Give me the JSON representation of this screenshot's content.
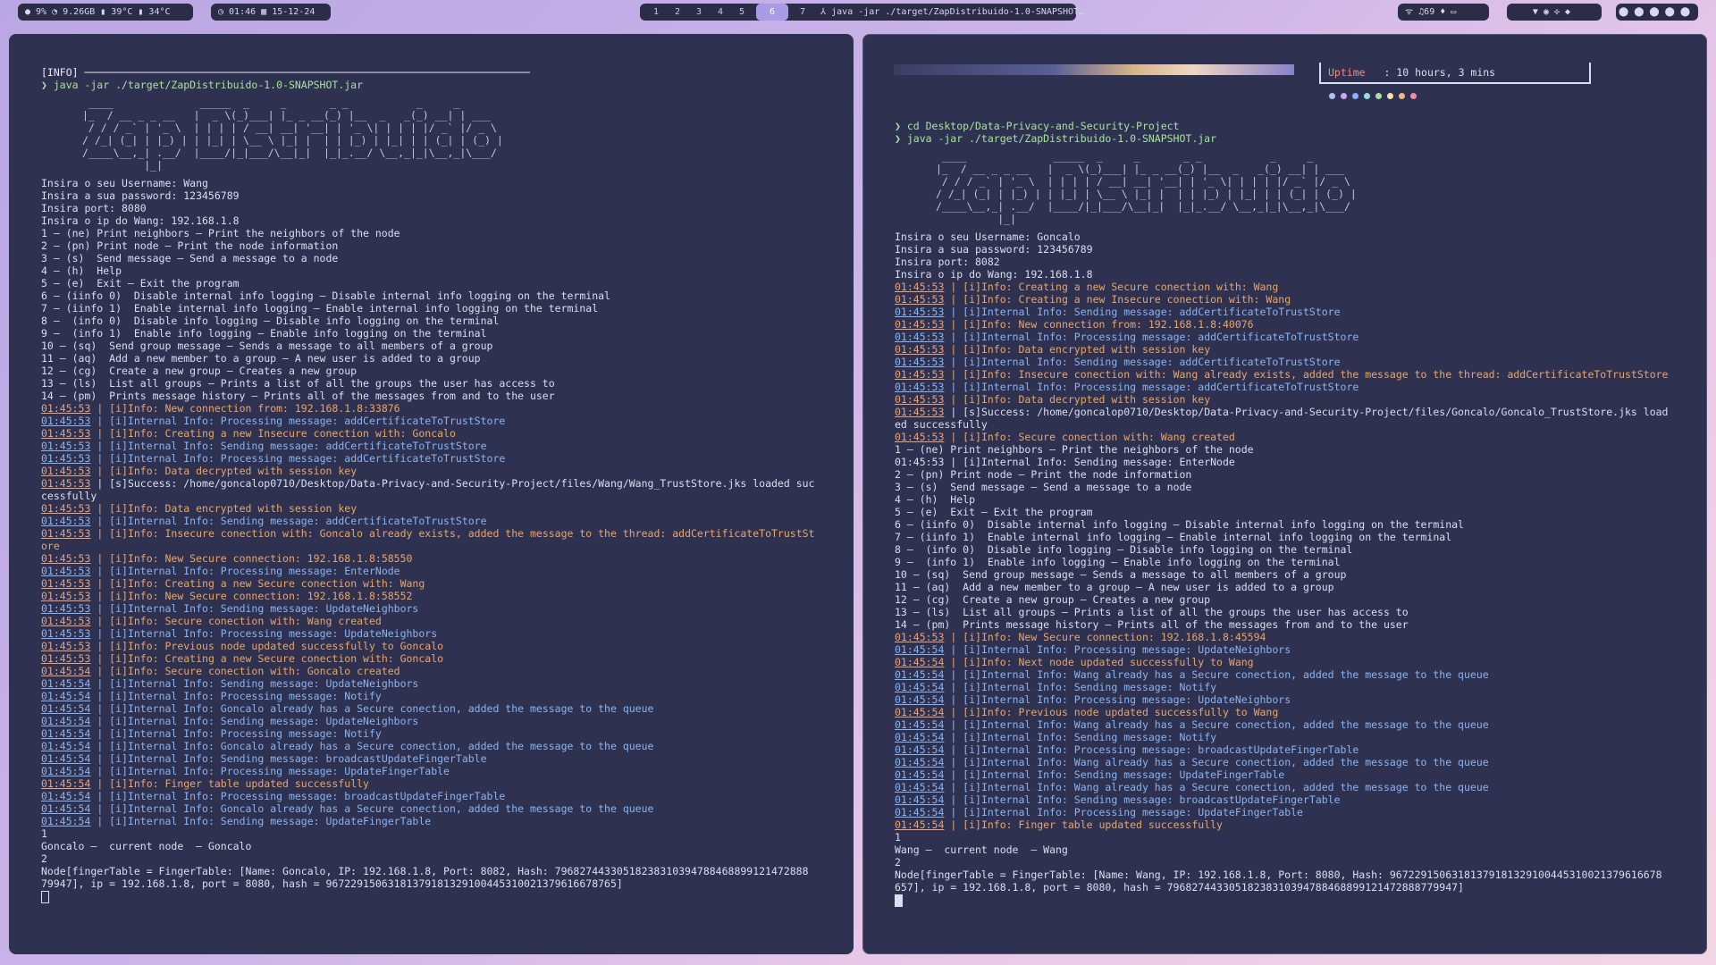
{
  "topbar": {
    "stats": [
      "● 9%",
      "◔ 9.26GB",
      "▮ 39°C",
      "▮ 34°C"
    ],
    "clock": "◷ 01:46",
    "date": "▦ 15-12-24",
    "workspaces": [
      "1",
      "2",
      "3",
      "4",
      "5",
      "6",
      "7"
    ],
    "active_workspace": "6",
    "window_title": "⅄ java -jar ./target/ZapDistribuido-1.0-SNAPSHOT…",
    "wifi": "ᯤ ♫69 ♦ ▭",
    "tray": "▼ ◉ ✣ ◆",
    "icons": "⬤ ⬤ ⬤ ⬤ ⬤"
  },
  "left_terminal": {
    "header_info": "[INFO] ────────────────────────────────────────────────────────────────────────",
    "command": "❯ java -jar ./target/ZapDistribuido-1.0-SNAPSHOT.jar",
    "ascii_art": " ____              _____  _     _       _ _           _     _       \n|_  / __ _ _ __   |  _ \\(_)___| |_ _ __(_) |__  _   _(_) __| | ___  \n / / / _` | '_ \\  | | | | / __| __| '__| | '_ \\| | | | |/ _` |/ _ \\ \n/ /_| (_| | |_) | | |_| | \\__ \\ |_| |  | | |_) | |_| | | (_| | (_) |\n/____\\__,_| .__/  |____/|_|___/\\__|_|  |_|_.__/ \\__,_|_|\\__,_|\\___/ \n          |_|",
    "lines": [
      "Insira o seu Username: Wang",
      "Insira a sua password: 123456789",
      "Insira port: 8080",
      "Insira o ip do Wang: 192.168.1.8",
      "1 – (ne) Print neighbors – Print the neighbors of the node",
      "2 – (pn) Print node – Print the node information",
      "3 – (s)  Send message – Send a message to a node",
      "4 – (h)  Help",
      "5 – (e)  Exit – Exit the program",
      "6 – (iinfo 0)  Disable internal info logging – Disable internal info logging on the terminal",
      "7 – (iinfo 1)  Enable internal info logging – Enable internal info logging on the terminal",
      "8 –  (info 0)  Disable info logging – Disable info logging on the terminal",
      "9 –  (info 1)  Enable info logging – Enable info logging on the terminal",
      "10 – (sq)  Send group message – Sends a message to all members of a group",
      "11 – (aq)  Add a new member to a group – A new user is added to a group",
      "12 – (cg)  Create a new group – Creates a new group",
      "13 – (ls)  List all groups – Prints a list of all the groups the user has access to",
      "14 – (pm)  Prints message history – Prints all of the messages from and to the user"
    ],
    "logs": [
      {
        "t": "01:45:53",
        "m": "| [i]Info: New connection from: 192.168.1.8:33876",
        "c": "warn"
      },
      {
        "t": "01:45:53",
        "m": "| [i]Internal Info: Processing message: addCertificateToTrustStore",
        "c": "info"
      },
      {
        "t": "01:45:53",
        "m": "| [i]Info: Creating a new Insecure conection with: Goncalo",
        "c": "warn"
      },
      {
        "t": "01:45:53",
        "m": "| [i]Internal Info: Sending message: addCertificateToTrustStore",
        "c": "info"
      },
      {
        "t": "01:45:53",
        "m": "| [i]Internal Info: Processing message: addCertificateToTrustStore",
        "c": "info"
      },
      {
        "t": "01:45:53",
        "m": "| [i]Info: Data decrypted with session key",
        "c": "warn"
      },
      {
        "t": "01:45:53",
        "m": "| [s]Success: /home/goncalop0710/Desktop/Data-Privacy-and-Security-Project/files/Wang/Wang_TrustStore.jks loaded suc",
        "c": "ok"
      },
      {
        "t": "",
        "m": "cessfully",
        "c": "ok"
      },
      {
        "t": "01:45:53",
        "m": "| [i]Info: Data encrypted with session key",
        "c": "warn"
      },
      {
        "t": "01:45:53",
        "m": "| [i]Internal Info: Sending message: addCertificateToTrustStore",
        "c": "info"
      },
      {
        "t": "01:45:53",
        "m": "| [i]Info: Insecure conection with: Goncalo already exists, added the message to the thread: addCertificateToTrustSt",
        "c": "warn"
      },
      {
        "t": "",
        "m": "ore",
        "c": "warn"
      },
      {
        "t": "01:45:53",
        "m": "| [i]Info: New Secure connection: 192.168.1.8:58550",
        "c": "warn"
      },
      {
        "t": "01:45:53",
        "m": "| [i]Internal Info: Processing message: EnterNode",
        "c": "info"
      },
      {
        "t": "01:45:53",
        "m": "| [i]Info: Creating a new Secure conection with: Wang",
        "c": "warn"
      },
      {
        "t": "01:45:53",
        "m": "| [i]Info: New Secure connection: 192.168.1.8:58552",
        "c": "warn"
      },
      {
        "t": "01:45:53",
        "m": "| [i]Internal Info: Sending message: UpdateNeighbors",
        "c": "info"
      },
      {
        "t": "01:45:53",
        "m": "| [i]Info: Secure conection with: Wang created",
        "c": "warn"
      },
      {
        "t": "01:45:53",
        "m": "| [i]Internal Info: Processing message: UpdateNeighbors",
        "c": "info"
      },
      {
        "t": "01:45:53",
        "m": "| [i]Info: Previous node updated successfully to Goncalo",
        "c": "warn"
      },
      {
        "t": "01:45:53",
        "m": "| [i]Info: Creating a new Secure conection with: Goncalo",
        "c": "warn"
      },
      {
        "t": "01:45:54",
        "m": "| [i]Info: Secure conection with: Goncalo created",
        "c": "warn"
      },
      {
        "t": "01:45:54",
        "m": "| [i]Internal Info: Sending message: UpdateNeighbors",
        "c": "info"
      },
      {
        "t": "01:45:54",
        "m": "| [i]Internal Info: Processing message: Notify",
        "c": "info"
      },
      {
        "t": "01:45:54",
        "m": "| [i]Internal Info: Goncalo already has a Secure conection, added the message to the queue",
        "c": "info"
      },
      {
        "t": "01:45:54",
        "m": "| [i]Internal Info: Sending message: UpdateNeighbors",
        "c": "info"
      },
      {
        "t": "01:45:54",
        "m": "| [i]Internal Info: Processing message: Notify",
        "c": "info"
      },
      {
        "t": "01:45:54",
        "m": "| [i]Internal Info: Goncalo already has a Secure conection, added the message to the queue",
        "c": "info"
      },
      {
        "t": "01:45:54",
        "m": "| [i]Internal Info: Sending message: broadcastUpdateFingerTable",
        "c": "info"
      },
      {
        "t": "01:45:54",
        "m": "| [i]Internal Info: Processing message: UpdateFingerTable",
        "c": "info"
      },
      {
        "t": "01:45:54",
        "m": "| [i]Info: Finger table updated successfully",
        "c": "warn"
      },
      {
        "t": "01:45:54",
        "m": "| [i]Internal Info: Processing message: broadcastUpdateFingerTable",
        "c": "info"
      },
      {
        "t": "01:45:54",
        "m": "| [i]Internal Info: Goncalo already has a Secure conection, added the message to the queue",
        "c": "info"
      },
      {
        "t": "01:45:54",
        "m": "| [i]Internal Info: Sending message: UpdateFingerTable",
        "c": "info"
      }
    ],
    "tail": [
      "1",
      "Goncalo –  current node  – Goncalo",
      "2",
      "Node[fingerTable = FingerTable: [Name: Goncalo, IP: 192.168.1.8, Port: 8082, Hash: 79682744330518238310394788468899121472888",
      "79947], ip = 192.168.1.8, port = 8080, hash = 96722915063181379181329100445310021379616678765]"
    ]
  },
  "right_terminal": {
    "uptime_label": "Uptime",
    "uptime_value": ": 10 hours, 3 mins",
    "commands": [
      "❯ cd Desktop/Data-Privacy-and-Security-Project",
      "❯ java -jar ./target/ZapDistribuido-1.0-SNAPSHOT.jar"
    ],
    "lines_top": [
      "Insira o seu Username: Goncalo",
      "Insira a sua password: 123456789",
      "Insira port: 8082",
      "Insira o ip do Wang: 192.168.1.8"
    ],
    "logs1": [
      {
        "t": "01:45:53",
        "m": "| [i]Info: Creating a new Secure conection with: Wang",
        "c": "warn"
      },
      {
        "t": "01:45:53",
        "m": "| [i]Info: Creating a new Insecure conection with: Wang",
        "c": "warn"
      },
      {
        "t": "01:45:53",
        "m": "| [i]Internal Info: Sending message: addCertificateToTrustStore",
        "c": "info"
      },
      {
        "t": "01:45:53",
        "m": "| [i]Info: New connection from: 192.168.1.8:40076",
        "c": "warn"
      },
      {
        "t": "01:45:53",
        "m": "| [i]Internal Info: Processing message: addCertificateToTrustStore",
        "c": "info"
      },
      {
        "t": "01:45:53",
        "m": "| [i]Info: Data encrypted with session key",
        "c": "warn"
      },
      {
        "t": "01:45:53",
        "m": "| [i]Internal Info: Sending message: addCertificateToTrustStore",
        "c": "info"
      },
      {
        "t": "01:45:53",
        "m": "| [i]Info: Insecure conection with: Wang already exists, added the message to the thread: addCertificateToTrustStore",
        "c": "warn"
      },
      {
        "t": "01:45:53",
        "m": "| [i]Internal Info: Processing message: addCertificateToTrustStore",
        "c": "info"
      },
      {
        "t": "01:45:53",
        "m": "| [i]Info: Data decrypted with session key",
        "c": "warn"
      },
      {
        "t": "01:45:53",
        "m": "| [s]Success: /home/goncalop0710/Desktop/Data-Privacy-and-Security-Project/files/Goncalo/Goncalo_TrustStore.jks load",
        "c": "ok"
      },
      {
        "t": "",
        "m": "ed successfully",
        "c": "ok"
      },
      {
        "t": "01:45:53",
        "m": "| [i]Info: Secure conection with: Wang created",
        "c": "warn"
      }
    ],
    "menu": [
      "1 – (ne) Print neighbors – Print the neighbors of the node",
      "01:45:53 | [i]Internal Info: Sending message: EnterNode",
      "2 – (pn) Print node – Print the node information",
      "3 – (s)  Send message – Send a message to a node",
      "4 – (h)  Help",
      "5 – (e)  Exit – Exit the program",
      "6 – (iinfo 0)  Disable internal info logging – Disable internal info logging on the terminal",
      "7 – (iinfo 1)  Enable internal info logging – Enable internal info logging on the terminal",
      "8 –  (info 0)  Disable info logging – Disable info logging on the terminal",
      "9 –  (info 1)  Enable info logging – Enable info logging on the terminal",
      "10 – (sq)  Send group message – Sends a message to all members of a group",
      "11 – (aq)  Add a new member to a group – A new user is added to a group",
      "12 – (cg)  Create a new group – Creates a new group",
      "13 – (ls)  List all groups – Prints a list of all the groups the user has access to",
      "14 – (pm)  Prints message history – Prints all of the messages from and to the user"
    ],
    "logs2": [
      {
        "t": "01:45:53",
        "m": "| [i]Info: New Secure connection: 192.168.1.8:45594",
        "c": "warn"
      },
      {
        "t": "01:45:54",
        "m": "| [i]Internal Info: Processing message: UpdateNeighbors",
        "c": "info"
      },
      {
        "t": "01:45:54",
        "m": "| [i]Info: Next node updated successfully to Wang",
        "c": "warn"
      },
      {
        "t": "01:45:54",
        "m": "| [i]Internal Info: Wang already has a Secure conection, added the message to the queue",
        "c": "info"
      },
      {
        "t": "01:45:54",
        "m": "| [i]Internal Info: Sending message: Notify",
        "c": "info"
      },
      {
        "t": "01:45:54",
        "m": "| [i]Internal Info: Processing message: UpdateNeighbors",
        "c": "info"
      },
      {
        "t": "01:45:54",
        "m": "| [i]Info: Previous node updated successfully to Wang",
        "c": "warn"
      },
      {
        "t": "01:45:54",
        "m": "| [i]Internal Info: Wang already has a Secure conection, added the message to the queue",
        "c": "info"
      },
      {
        "t": "01:45:54",
        "m": "| [i]Internal Info: Sending message: Notify",
        "c": "info"
      },
      {
        "t": "01:45:54",
        "m": "| [i]Internal Info: Processing message: broadcastUpdateFingerTable",
        "c": "info"
      },
      {
        "t": "01:45:54",
        "m": "| [i]Internal Info: Wang already has a Secure conection, added the message to the queue",
        "c": "info"
      },
      {
        "t": "01:45:54",
        "m": "| [i]Internal Info: Sending message: UpdateFingerTable",
        "c": "info"
      },
      {
        "t": "01:45:54",
        "m": "| [i]Internal Info: Wang already has a Secure conection, added the message to the queue",
        "c": "info"
      },
      {
        "t": "01:45:54",
        "m": "| [i]Internal Info: Sending message: broadcastUpdateFingerTable",
        "c": "info"
      },
      {
        "t": "01:45:54",
        "m": "| [i]Internal Info: Processing message: UpdateFingerTable",
        "c": "info"
      },
      {
        "t": "01:45:54",
        "m": "| [i]Info: Finger table updated successfully",
        "c": "warn"
      }
    ],
    "tail": [
      "1",
      "Wang –  current node  – Wang",
      "2",
      "Node[fingerTable = FingerTable: [Name: Wang, IP: 192.168.1.8, Port: 8080, Hash: 96722915063181379181329100445310021379616678",
      "657], ip = 192.168.1.8, port = 8080, hash = 79682744330518238310394788468899121472888779947]"
    ]
  },
  "colors": {
    "dots": [
      "#b4befe",
      "#cba6f7",
      "#89b4fa",
      "#94e2d5",
      "#a6e3a1",
      "#f9e2af",
      "#fab387",
      "#f38ba8"
    ]
  }
}
